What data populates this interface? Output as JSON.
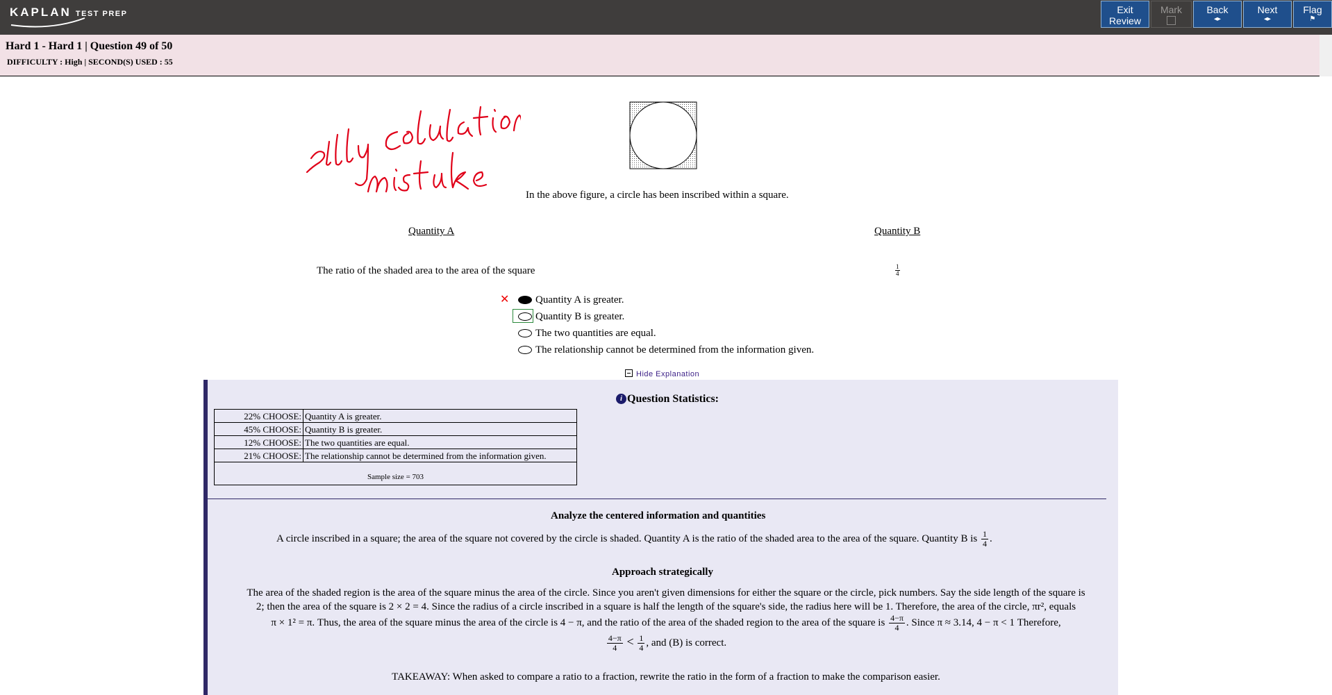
{
  "header": {
    "logo_main": "KAPLAN",
    "logo_sub": "TEST PREP",
    "buttons": {
      "exit_review_line1": "Exit",
      "exit_review_line2": "Review",
      "mark": "Mark",
      "back": "Back",
      "next": "Next",
      "flag": "Flag"
    },
    "colors": {
      "bar": "#3f3d3c",
      "button": "#1f4f8c"
    }
  },
  "info": {
    "title": "Hard 1 - Hard 1 | Question  49 of 50",
    "difficulty_line": "DIFFICULTY : High | SECOND(S) USED : 55"
  },
  "annotation": {
    "line1": "silly calculation",
    "line2": "mistake"
  },
  "question": {
    "stem": "In the above figure, a circle has been inscribed within a square.",
    "quantity_a_header": "Quantity A",
    "quantity_b_header": "Quantity B",
    "quantity_a_text": "The ratio of the shaded area to the area of the square",
    "quantity_b_num": "1",
    "quantity_b_den": "4",
    "choices": [
      {
        "label": "Quantity A is greater.",
        "selected": true,
        "wrong": true
      },
      {
        "label": "Quantity B is greater.",
        "correct": true
      },
      {
        "label": "The two quantities are equal."
      },
      {
        "label": "The relationship cannot be determined from the information given."
      }
    ],
    "wrong_mark": "✕"
  },
  "explanation": {
    "toggle_label": "Hide Explanation",
    "stats_title": "Question Statistics:",
    "info_icon": "i",
    "stats": [
      {
        "pct": "22% CHOOSE:",
        "answer": "Quantity A is greater."
      },
      {
        "pct": "45% CHOOSE:",
        "answer": "Quantity B is greater."
      },
      {
        "pct": "12% CHOOSE:",
        "answer": "The two quantities are equal."
      },
      {
        "pct": "21% CHOOSE:",
        "answer": "The relationship cannot be determined from the information given."
      }
    ],
    "sample": "Sample size = 703",
    "h1": "Analyze the centered information and quantities",
    "p1": "A circle inscribed in a square; the area of the square not covered by the circle is shaded. Quantity A is the ratio of the shaded area to the area of the square. Quantity B is",
    "h2": "Approach strategically",
    "p2_line1": "The area of the shaded region is the area of the square minus the area of the circle. Since you aren't given dimensions for either the square or the circle, pick numbers. Say the side length of the square is",
    "p2_line2": "2; then the area of the square is 2 × 2 = 4. Since the radius of a circle inscribed in a square is half the length of the square's side, the radius here will be 1. Therefore, the area of the circle, πr², equals",
    "p2_line3a": "π × 1² = π. Thus, the area of the square minus the area of the circle is 4 − π, and the ratio of the area of the shaded region to the area of the square is",
    "p2_line3b": ". Since π ≈ 3.14, 4 − π < 1 Therefore,",
    "p2_line4": ", and (B) is correct.",
    "frac_num": "4−π",
    "frac_den": "4",
    "lt": "<",
    "one": "1",
    "takeaway": "TAKEAWAY: When asked to compare a ratio to a fraction, rewrite the ratio in the form of a fraction to make the comparison easier.",
    "colors": {
      "panel": "#e9e8f4",
      "border": "#2f2867"
    }
  }
}
